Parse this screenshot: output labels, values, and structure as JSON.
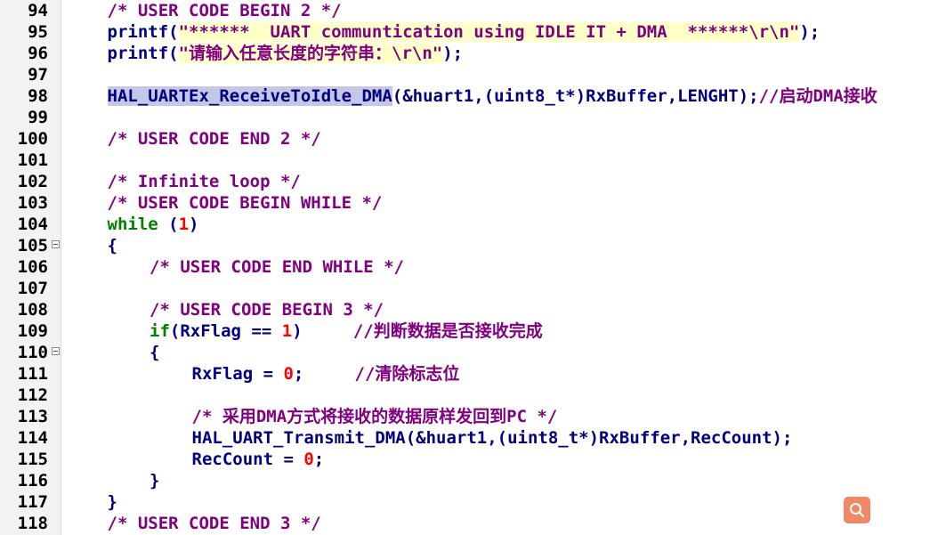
{
  "editor": {
    "lines": [
      {
        "num": "94",
        "indent": 1,
        "fold": false,
        "tokens": [
          {
            "t": "c",
            "v": "/* USER CODE BEGIN 2 */"
          }
        ]
      },
      {
        "num": "95",
        "indent": 1,
        "fold": false,
        "tokens": [
          {
            "t": "fn",
            "v": "printf("
          },
          {
            "t": "st",
            "v": "\"******  UART communtication using IDLE IT + DMA  ******\\r\\n\""
          },
          {
            "t": "pu",
            "v": ");"
          }
        ]
      },
      {
        "num": "96",
        "indent": 1,
        "fold": false,
        "tokens": [
          {
            "t": "fn",
            "v": "printf("
          },
          {
            "t": "st",
            "v": "\"请输入任意长度的字符串：\\r\\n\""
          },
          {
            "t": "pu",
            "v": ");"
          }
        ]
      },
      {
        "num": "97",
        "indent": 0,
        "fold": false,
        "tokens": []
      },
      {
        "num": "98",
        "indent": 1,
        "fold": false,
        "tokens": [
          {
            "t": "hl",
            "v": "HAL_UARTEx_ReceiveToIdle_DMA"
          },
          {
            "t": "pu",
            "v": "(&huart1,(uint8_t*)RxBuffer,LENGHT);"
          },
          {
            "t": "c",
            "v": "//启动DMA接收"
          }
        ]
      },
      {
        "num": "99",
        "indent": 0,
        "fold": false,
        "tokens": []
      },
      {
        "num": "100",
        "indent": 1,
        "fold": false,
        "tokens": [
          {
            "t": "c",
            "v": "/* USER CODE END 2 */"
          }
        ]
      },
      {
        "num": "101",
        "indent": 0,
        "fold": false,
        "tokens": []
      },
      {
        "num": "102",
        "indent": 1,
        "fold": false,
        "tokens": [
          {
            "t": "c",
            "v": "/* Infinite loop */"
          }
        ]
      },
      {
        "num": "103",
        "indent": 1,
        "fold": false,
        "tokens": [
          {
            "t": "c",
            "v": "/* USER CODE BEGIN WHILE */"
          }
        ]
      },
      {
        "num": "104",
        "indent": 1,
        "fold": false,
        "tokens": [
          {
            "t": "kw",
            "v": "while"
          },
          {
            "t": "pu",
            "v": " ("
          },
          {
            "t": "nu",
            "v": "1"
          },
          {
            "t": "pu",
            "v": ")"
          }
        ]
      },
      {
        "num": "105",
        "indent": 1,
        "fold": true,
        "tokens": [
          {
            "t": "pu",
            "v": "{"
          }
        ]
      },
      {
        "num": "106",
        "indent": 2,
        "fold": false,
        "tokens": [
          {
            "t": "c",
            "v": "/* USER CODE END WHILE */"
          }
        ]
      },
      {
        "num": "107",
        "indent": 0,
        "fold": false,
        "tokens": []
      },
      {
        "num": "108",
        "indent": 2,
        "fold": false,
        "tokens": [
          {
            "t": "c",
            "v": "/* USER CODE BEGIN 3 */"
          }
        ]
      },
      {
        "num": "109",
        "indent": 2,
        "fold": false,
        "tokens": [
          {
            "t": "kw",
            "v": "if"
          },
          {
            "t": "pu",
            "v": "(RxFlag == "
          },
          {
            "t": "nu",
            "v": "1"
          },
          {
            "t": "pu",
            "v": ")     "
          },
          {
            "t": "c",
            "v": "//判断数据是否接收完成"
          }
        ]
      },
      {
        "num": "110",
        "indent": 2,
        "fold": true,
        "tokens": [
          {
            "t": "pu",
            "v": "{"
          }
        ]
      },
      {
        "num": "111",
        "indent": 3,
        "fold": false,
        "tokens": [
          {
            "t": "pu",
            "v": "RxFlag = "
          },
          {
            "t": "nu",
            "v": "0"
          },
          {
            "t": "pu",
            "v": ";     "
          },
          {
            "t": "c",
            "v": "//清除标志位"
          }
        ]
      },
      {
        "num": "112",
        "indent": 0,
        "fold": false,
        "tokens": []
      },
      {
        "num": "113",
        "indent": 3,
        "fold": false,
        "tokens": [
          {
            "t": "c",
            "v": "/* 采用DMA方式将接收的数据原样发回到PC */"
          }
        ]
      },
      {
        "num": "114",
        "indent": 3,
        "fold": false,
        "tokens": [
          {
            "t": "pu",
            "v": "HAL_UART_Transmit_DMA(&huart1,(uint8_t*)RxBuffer,RecCount);"
          }
        ]
      },
      {
        "num": "115",
        "indent": 3,
        "fold": false,
        "tokens": [
          {
            "t": "pu",
            "v": "RecCount = "
          },
          {
            "t": "nu",
            "v": "0"
          },
          {
            "t": "pu",
            "v": ";"
          }
        ]
      },
      {
        "num": "116",
        "indent": 2,
        "fold": false,
        "tokens": [
          {
            "t": "pu",
            "v": "}"
          }
        ]
      },
      {
        "num": "117",
        "indent": 1,
        "fold": false,
        "tokens": [
          {
            "t": "pu",
            "v": "}"
          }
        ]
      },
      {
        "num": "118",
        "indent": 1,
        "fold": false,
        "tokens": [
          {
            "t": "c",
            "v": "/* USER CODE END 3 */"
          }
        ]
      }
    ]
  },
  "zoom_button": {
    "icon": "magnifier-icon"
  },
  "colors": {
    "comment": "#800080",
    "keyword": "#008000",
    "identifier": "#000080",
    "string_bg": "#ffffc8",
    "number": "#ff0000",
    "selection": "#c6c6e6",
    "zoom_button": "#f08868"
  }
}
